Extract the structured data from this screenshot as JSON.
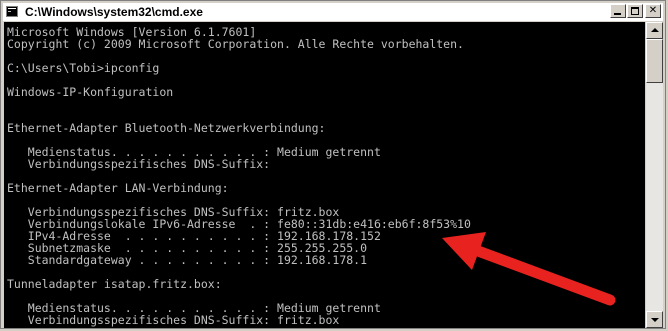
{
  "window": {
    "title": "C:\\Windows\\system32\\cmd.exe",
    "icon": "cmd-icon"
  },
  "title_buttons": {
    "minimize": "minimize-icon",
    "maximize": "maximize-icon",
    "close": "close-icon"
  },
  "console": {
    "background": "#000000",
    "text_color": "#c0c0c0",
    "lines": [
      "Microsoft Windows [Version 6.1.7601]",
      "Copyright (c) 2009 Microsoft Corporation. Alle Rechte vorbehalten.",
      "",
      "C:\\Users\\Tobi>ipconfig",
      "",
      "Windows-IP-Konfiguration",
      "",
      "",
      "Ethernet-Adapter Bluetooth-Netzwerkverbindung:",
      "",
      "   Medienstatus. . . . . . . . . . . : Medium getrennt",
      "   Verbindungsspezifisches DNS-Suffix:",
      "",
      "Ethernet-Adapter LAN-Verbindung:",
      "",
      "   Verbindungsspezifisches DNS-Suffix: fritz.box",
      "   Verbindungslokale IPv6-Adresse  . : fe80::31db:e416:eb6f:8f53%10",
      "   IPv4-Adresse  . . . . . . . . . . : 192.168.178.152",
      "   Subnetzmaske  . . . . . . . . . . : 255.255.255.0",
      "   Standardgateway . . . . . . . . . : 192.168.178.1",
      "",
      "Tunneladapter isatap.fritz.box:",
      "",
      "   Medienstatus. . . . . . . . . . . : Medium getrennt",
      "   Verbindungsspezifisches DNS-Suffix: fritz.box"
    ]
  },
  "annotation": {
    "color": "#e8231f",
    "icon": "red-arrow-icon"
  },
  "scrollbar": {
    "up_icon": "scroll-up-icon",
    "down_icon": "scroll-down-icon"
  }
}
